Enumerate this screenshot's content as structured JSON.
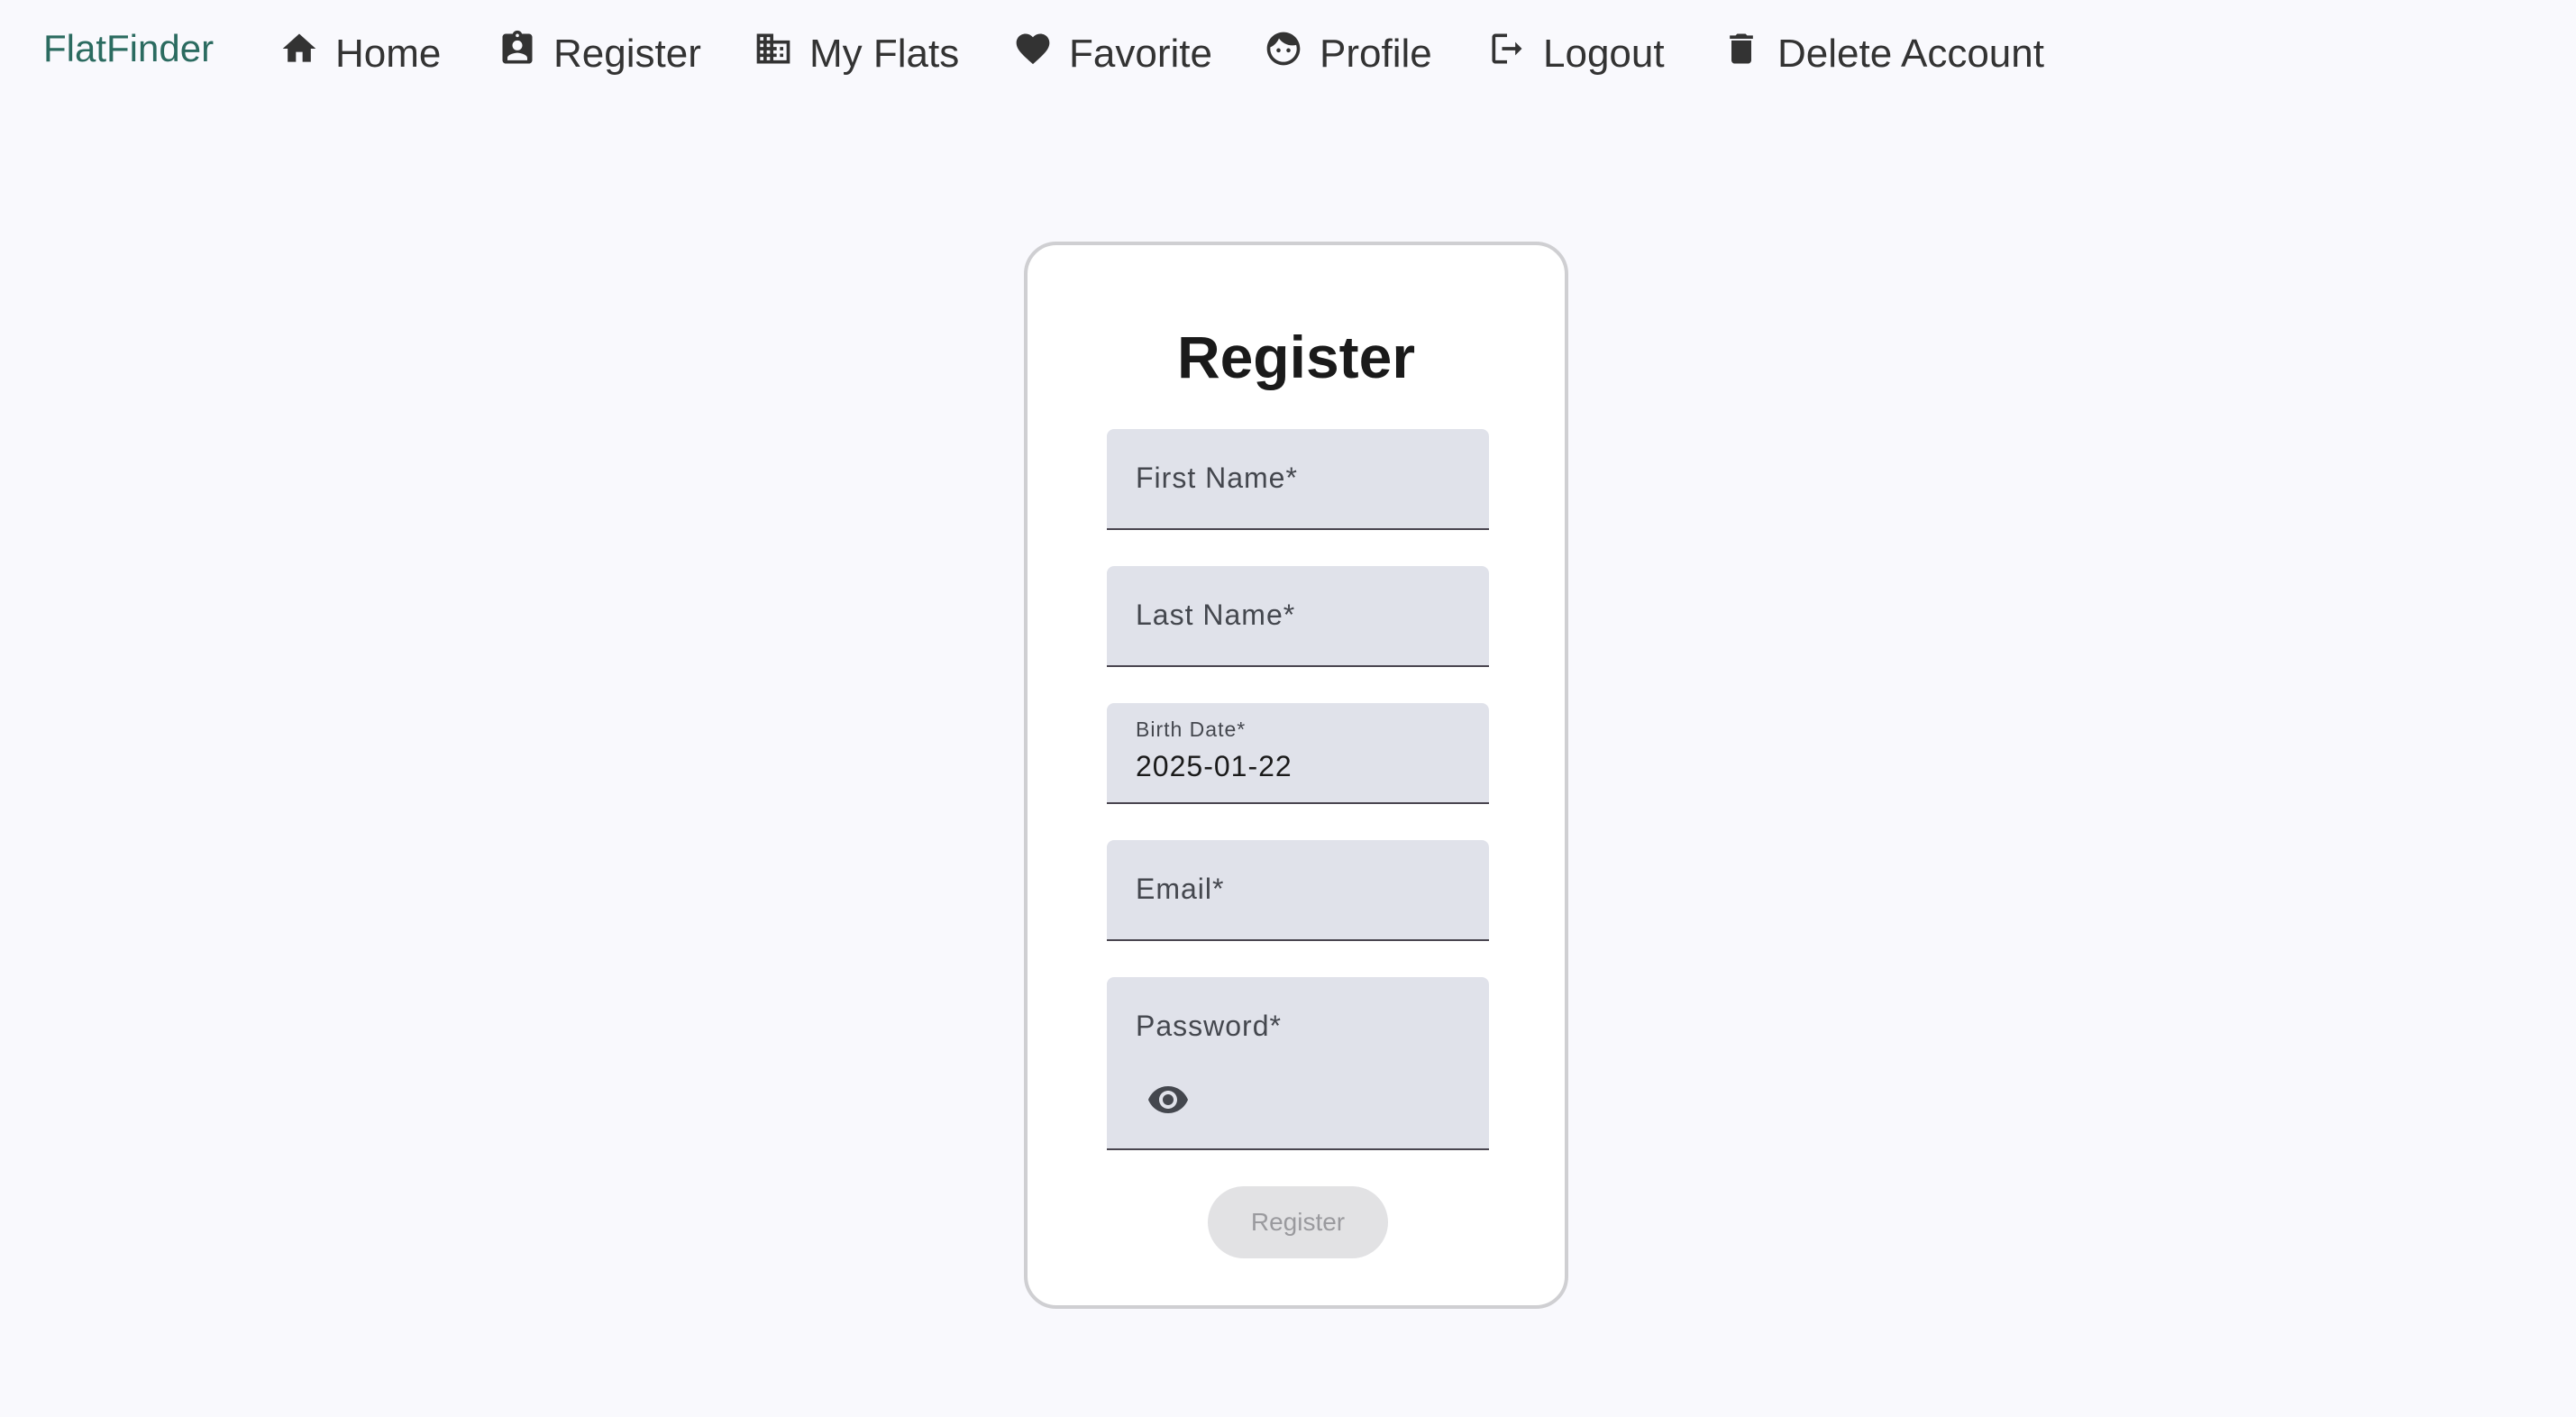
{
  "nav": {
    "brand": "FlatFinder",
    "items": [
      {
        "label": "Home",
        "icon": "home-icon"
      },
      {
        "label": "Register",
        "icon": "id-badge-icon"
      },
      {
        "label": "My Flats",
        "icon": "building-icon"
      },
      {
        "label": "Favorite",
        "icon": "heart-icon"
      },
      {
        "label": "Profile",
        "icon": "face-icon"
      },
      {
        "label": "Logout",
        "icon": "logout-icon"
      },
      {
        "label": "Delete Account",
        "icon": "trash-icon"
      }
    ]
  },
  "form": {
    "title": "Register",
    "first_name_label": "First Name*",
    "last_name_label": "Last Name*",
    "birth_date_label": "Birth Date*",
    "birth_date_value": "2025-01-22",
    "email_label": "Email*",
    "password_label": "Password*",
    "password_toggle_icon": "eye-icon",
    "submit_label": "Register"
  },
  "colors": {
    "brand": "#2b6b60",
    "background": "#f9f9fd",
    "field_fill": "#e0e2ea",
    "button_disabled": "#e2e2e4"
  }
}
